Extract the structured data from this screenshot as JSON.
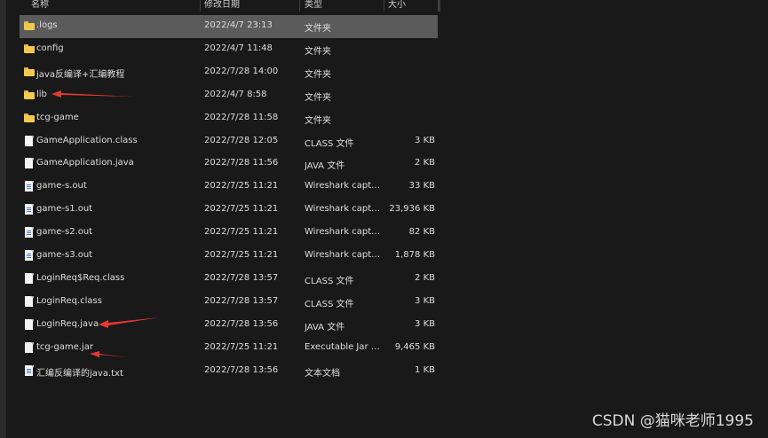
{
  "columns": {
    "name": "名称",
    "date": "修改日期",
    "type": "类型",
    "size": "大小"
  },
  "files": [
    {
      "name": ".logs",
      "date": "2022/4/7 23:13",
      "type": "文件夹",
      "size": "",
      "icon": "folder-icon",
      "selected": true
    },
    {
      "name": "config",
      "date": "2022/4/7 11:48",
      "type": "文件夹",
      "size": "",
      "icon": "folder-icon"
    },
    {
      "name": "java反编译+汇编教程",
      "date": "2022/7/28 14:00",
      "type": "文件夹",
      "size": "",
      "icon": "folder-icon"
    },
    {
      "name": "lib",
      "date": "2022/4/7 8:58",
      "type": "文件夹",
      "size": "",
      "icon": "folder-icon"
    },
    {
      "name": "tcg-game",
      "date": "2022/7/28 11:58",
      "type": "文件夹",
      "size": "",
      "icon": "folder-icon"
    },
    {
      "name": "GameApplication.class",
      "date": "2022/7/28 12:05",
      "type": "CLASS 文件",
      "size": "3 KB",
      "icon": "file-icon"
    },
    {
      "name": "GameApplication.java",
      "date": "2022/7/28 11:56",
      "type": "JAVA 文件",
      "size": "2 KB",
      "icon": "file-icon"
    },
    {
      "name": "game-s.out",
      "date": "2022/7/25 11:21",
      "type": "Wireshark captu...",
      "size": "33 KB",
      "icon": "capture-file-icon"
    },
    {
      "name": "game-s1.out",
      "date": "2022/7/25 11:21",
      "type": "Wireshark captu...",
      "size": "23,936 KB",
      "icon": "capture-file-icon"
    },
    {
      "name": "game-s2.out",
      "date": "2022/7/25 11:21",
      "type": "Wireshark captu...",
      "size": "82 KB",
      "icon": "capture-file-icon"
    },
    {
      "name": "game-s3.out",
      "date": "2022/7/25 11:21",
      "type": "Wireshark captu...",
      "size": "1,878 KB",
      "icon": "capture-file-icon"
    },
    {
      "name": "LoginReq$Req.class",
      "date": "2022/7/28 13:57",
      "type": "CLASS 文件",
      "size": "2 KB",
      "icon": "file-icon"
    },
    {
      "name": "LoginReq.class",
      "date": "2022/7/28 13:57",
      "type": "CLASS 文件",
      "size": "3 KB",
      "icon": "file-icon"
    },
    {
      "name": "LoginReq.java",
      "date": "2022/7/28 13:56",
      "type": "JAVA 文件",
      "size": "3 KB",
      "icon": "file-icon"
    },
    {
      "name": "tcg-game.jar",
      "date": "2022/7/25 11:21",
      "type": "Executable Jar File",
      "size": "9,465 KB",
      "icon": "jar-file-icon"
    },
    {
      "name": "汇编反编译的java.txt",
      "date": "2022/7/28 13:56",
      "type": "文本文档",
      "size": "1 KB",
      "icon": "text-file-icon"
    }
  ],
  "annotation_color": "#e53935",
  "watermark": "CSDN @猫咪老师1995"
}
